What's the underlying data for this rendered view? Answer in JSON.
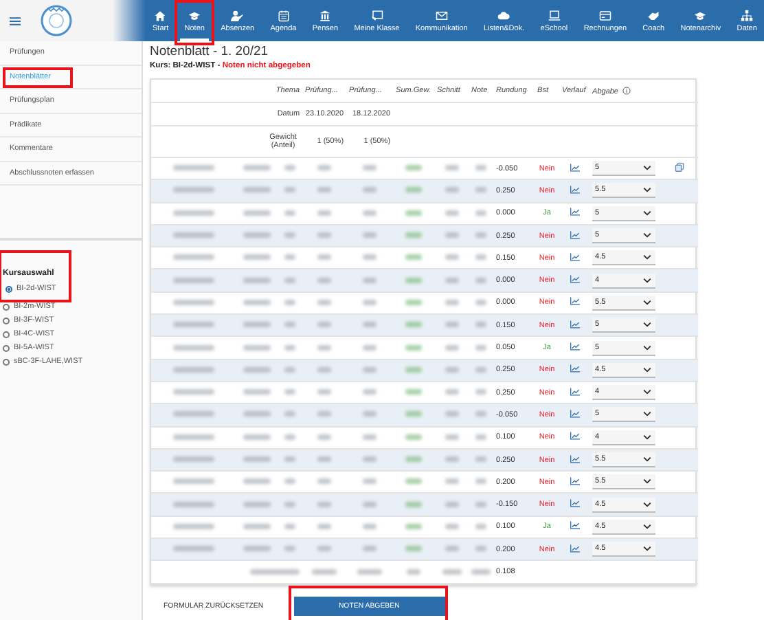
{
  "nav": [
    {
      "label": "Start",
      "selected": false
    },
    {
      "label": "Noten",
      "selected": true,
      "highlighted": true
    },
    {
      "label": "Absenzen",
      "selected": false
    },
    {
      "label": "Agenda",
      "selected": false
    },
    {
      "label": "Pensen",
      "selected": false
    },
    {
      "label": "Meine Klasse",
      "selected": false
    },
    {
      "label": "Kommunikation",
      "selected": false
    },
    {
      "label": "Listen&Dok.",
      "selected": false
    },
    {
      "label": "eSchool",
      "selected": false
    },
    {
      "label": "Rechnungen",
      "selected": false
    },
    {
      "label": "Coach",
      "selected": false
    },
    {
      "label": "Notenarchiv",
      "selected": false
    },
    {
      "label": "Daten",
      "selected": false
    }
  ],
  "sidebar": {
    "items": [
      {
        "label": "Prüfungen",
        "selected": false,
        "highlighted": false
      },
      {
        "label": "Notenblätter",
        "selected": true,
        "highlighted": true
      },
      {
        "label": "Prüfungsplan",
        "selected": false,
        "highlighted": false
      },
      {
        "label": "Prädikate",
        "selected": false,
        "highlighted": false
      },
      {
        "label": "Kommentare",
        "selected": false,
        "highlighted": false
      },
      {
        "label": "Abschlussnoten erfassen",
        "selected": false,
        "highlighted": false
      }
    ],
    "course_heading": "Kursauswahl",
    "course_highlighted": true,
    "courses": [
      {
        "label": "BI-2d-WIST",
        "selected": true
      },
      {
        "label": "BI-2m-WIST",
        "selected": false
      },
      {
        "label": "BI-3F-WIST",
        "selected": false
      },
      {
        "label": "BI-4C-WIST",
        "selected": false
      },
      {
        "label": "BI-5A-WIST",
        "selected": false
      },
      {
        "label": "sBC-3F-LAHE,WIST",
        "selected": false
      }
    ]
  },
  "title": "Notenblatt - 1. 20/21",
  "course_line": {
    "label": "Kurs: BI-2d-WIST",
    "separator": " - ",
    "status": "Noten nicht abgegeben"
  },
  "table": {
    "header_rows": [
      {
        "label": "Thema",
        "cells": [
          "Prüfung...",
          "Prüfung...",
          "Sum.Gew.",
          "Schnitt",
          "Note",
          "Rundung",
          "Bst",
          "Verlauf",
          "Abgabe"
        ],
        "info_icon": true
      },
      {
        "label": "Datum",
        "cells": [
          "23.10.2020",
          "18.12.2020"
        ],
        "info_icon": false
      },
      {
        "label": "Gewicht (Anteil)",
        "cells": [
          "1 (50%)",
          "1 (50%)"
        ],
        "info_icon": false
      }
    ],
    "rows": [
      {
        "rundung": "-0.050",
        "bst": "Nein",
        "bst_ok": false,
        "abgabe": "5",
        "copy": true
      },
      {
        "rundung": "0.250",
        "bst": "Nein",
        "bst_ok": false,
        "abgabe": "5.5",
        "copy": false
      },
      {
        "rundung": "0.000",
        "bst": "Ja",
        "bst_ok": true,
        "abgabe": "5",
        "copy": false
      },
      {
        "rundung": "0.250",
        "bst": "Nein",
        "bst_ok": false,
        "abgabe": "5",
        "copy": false
      },
      {
        "rundung": "0.150",
        "bst": "Nein",
        "bst_ok": false,
        "abgabe": "4.5",
        "copy": false
      },
      {
        "rundung": "0.000",
        "bst": "Nein",
        "bst_ok": false,
        "abgabe": "4",
        "copy": false
      },
      {
        "rundung": "0.000",
        "bst": "Nein",
        "bst_ok": false,
        "abgabe": "5.5",
        "copy": false
      },
      {
        "rundung": "0.150",
        "bst": "Nein",
        "bst_ok": false,
        "abgabe": "5",
        "copy": false
      },
      {
        "rundung": "0.050",
        "bst": "Ja",
        "bst_ok": true,
        "abgabe": "5",
        "copy": false
      },
      {
        "rundung": "0.250",
        "bst": "Nein",
        "bst_ok": false,
        "abgabe": "4.5",
        "copy": false
      },
      {
        "rundung": "0.250",
        "bst": "Nein",
        "bst_ok": false,
        "abgabe": "4",
        "copy": false
      },
      {
        "rundung": "-0.050",
        "bst": "Nein",
        "bst_ok": false,
        "abgabe": "5",
        "copy": false
      },
      {
        "rundung": "0.100",
        "bst": "Nein",
        "bst_ok": false,
        "abgabe": "4",
        "copy": false
      },
      {
        "rundung": "0.250",
        "bst": "Nein",
        "bst_ok": false,
        "abgabe": "5.5",
        "copy": false
      },
      {
        "rundung": "0.200",
        "bst": "Nein",
        "bst_ok": false,
        "abgabe": "5.5",
        "copy": false
      },
      {
        "rundung": "-0.150",
        "bst": "Nein",
        "bst_ok": false,
        "abgabe": "4.5",
        "copy": false
      },
      {
        "rundung": "0.100",
        "bst": "Ja",
        "bst_ok": true,
        "abgabe": "4.5",
        "copy": false
      },
      {
        "rundung": "0.200",
        "bst": "Nein",
        "bst_ok": false,
        "abgabe": "4.5",
        "copy": false
      }
    ],
    "summary": {
      "rundung": "0.108"
    }
  },
  "buttons": [
    {
      "label": "FORMULAR ZURÜCKSETZEN",
      "kind": "flat",
      "highlighted": false
    },
    {
      "label": "NOTEN ABGEBEN",
      "kind": "primary",
      "highlighted": true
    }
  ]
}
